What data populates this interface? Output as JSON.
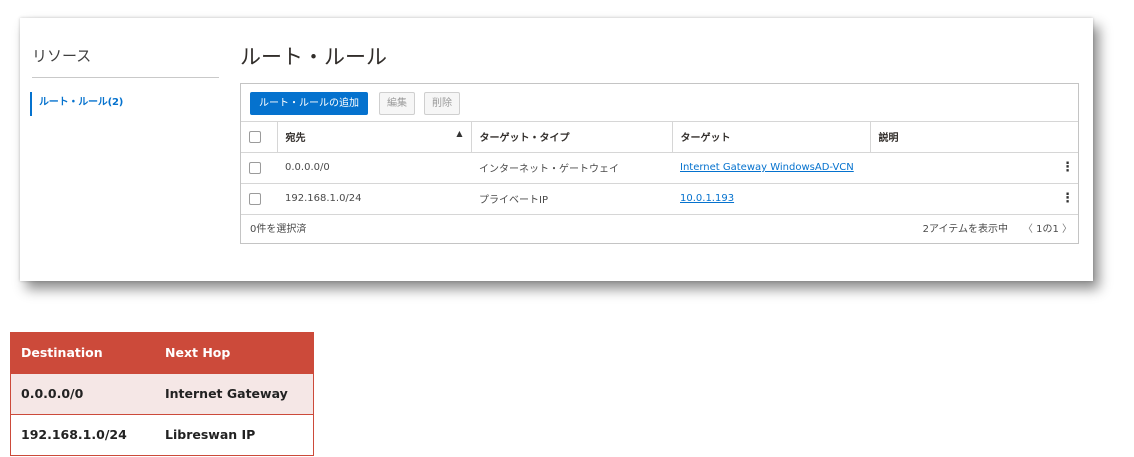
{
  "sidebar": {
    "title": "リソース",
    "items": [
      {
        "label": "ルート・ルール(2)"
      }
    ]
  },
  "main": {
    "title": "ルート・ルール",
    "toolbar": {
      "add_label": "ルート・ルールの追加",
      "edit_label": "編集",
      "delete_label": "削除"
    },
    "columns": [
      "宛先",
      "ターゲット・タイプ",
      "ターゲット",
      "説明"
    ],
    "rows": [
      {
        "destination": "0.0.0.0/0",
        "target_type": "インターネット・ゲートウェイ",
        "target": "Internet Gateway WindowsAD-VCN",
        "description": ""
      },
      {
        "destination": "192.168.1.0/24",
        "target_type": "プライベートIP",
        "target": "10.0.1.193",
        "description": ""
      }
    ],
    "footer": {
      "selected": "0件を選択済",
      "count": "2アイテムを表示中",
      "page": "1の1"
    }
  },
  "mapping_table": {
    "headers": [
      "Destination",
      "Next Hop"
    ],
    "rows": [
      [
        "0.0.0.0/0",
        "Internet Gateway"
      ],
      [
        "192.168.1.0/24",
        "Libreswan IP"
      ]
    ]
  },
  "colors": {
    "accent": "#0572ce",
    "table_header": "#cc4a3a",
    "table_row_alt": "#f5e7e6"
  }
}
